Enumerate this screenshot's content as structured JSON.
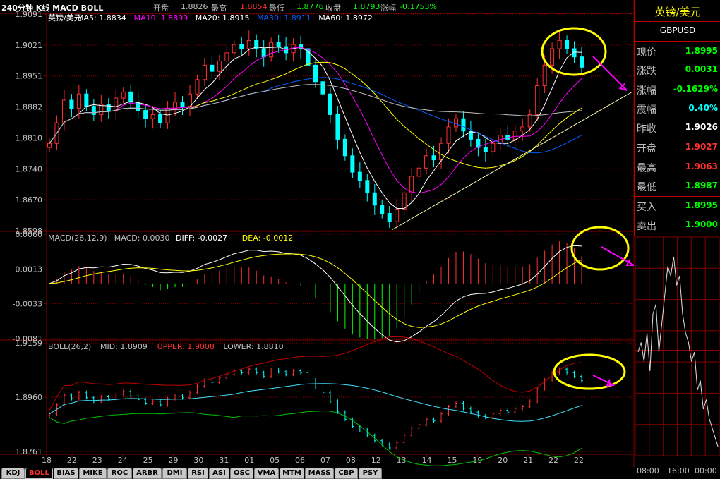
{
  "header": {
    "period_label": "240分钟 K线 MACD BOLL",
    "open_label": "开盘",
    "open_val": "1.8826",
    "high_label": "最高",
    "high_val": "1.8854",
    "low_label": "最低",
    "low_val": "1.8776",
    "close_label": "收盘",
    "close_val": "1.8793",
    "change_label": "涨幅",
    "change_val": "-0.1753%"
  },
  "side": {
    "title": "英镑/美元",
    "code": "GBPUSD",
    "rows": [
      {
        "label": "现价",
        "value": "1.8995",
        "color": "#00ff00"
      },
      {
        "label": "涨跌",
        "value": "0.0031",
        "color": "#00ff00"
      },
      {
        "label": "涨幅",
        "value": "-0.1629%",
        "color": "#00ff00"
      },
      {
        "label": "震幅",
        "value": "0.40%",
        "color": "#00ffff"
      },
      {
        "label": "昨收",
        "value": "1.9026",
        "color": "#ffffff"
      },
      {
        "label": "开盘",
        "value": "1.9027",
        "color": "#ff3030"
      },
      {
        "label": "最高",
        "value": "1.9063",
        "color": "#ff3030"
      },
      {
        "label": "最低",
        "value": "1.8987",
        "color": "#00ff00"
      },
      {
        "label": "买入",
        "value": "1.8995",
        "color": "#00ff00"
      },
      {
        "label": "卖出",
        "value": "1.9000",
        "color": "#00ff00"
      }
    ],
    "mini_times": [
      "08:00",
      "16:00",
      "00:00"
    ]
  },
  "tabs": [
    "KDJ",
    "BOLL",
    "BIAS",
    "MIKE",
    "ROC",
    "ARBR",
    "DMI",
    "RSI",
    "ASI",
    "OSC",
    "VMA",
    "MTM",
    "MASS",
    "CBP",
    "PSY"
  ],
  "active_tab": "BOLL",
  "colors": {
    "up": "#ff3030",
    "down": "#00ffff",
    "ma5": "#ffffff",
    "ma10": "#ff00ff",
    "ma20": "#ffff00",
    "ma30": "#0060ff",
    "ma60": "#ffffff",
    "grid": "#800000",
    "annotation": "#ffff00",
    "arrow": "#ff00ff"
  },
  "chart_data": [
    {
      "type": "candlestick",
      "name": "main",
      "legend": [
        {
          "text": "英镑/美元",
          "color": "#ffffff"
        },
        {
          "text": "MA5: 1.8834",
          "color": "#ffffff"
        },
        {
          "text": "MA10: 1.8899",
          "color": "#ff00ff"
        },
        {
          "text": "MA20: 1.8915",
          "color": "#ffffff"
        },
        {
          "text": "MA30: 1.8911",
          "color": "#0060ff"
        },
        {
          "text": "MA60: 1.8972",
          "color": "#ffffff"
        }
      ],
      "ylim": [
        1.8598,
        1.91
      ],
      "y_ticks": [
        "1.9091",
        "1.9021",
        "1.8951",
        "1.8882",
        "1.8810",
        "1.8740",
        "1.8670",
        "1.8598"
      ],
      "x_ticks": [
        "18",
        "22",
        "23",
        "24",
        "25",
        "29",
        "30",
        "31",
        "01",
        "05",
        "06",
        "07",
        "08",
        "12",
        "13",
        "14",
        "15",
        "19",
        "20",
        "21",
        "22",
        "22"
      ],
      "close": [
        1.881,
        1.886,
        1.8915,
        1.8895,
        1.893,
        1.89,
        1.888,
        1.8905,
        1.889,
        1.892,
        1.8935,
        1.891,
        1.889,
        1.887,
        1.888,
        1.886,
        1.8895,
        1.891,
        1.89,
        1.893,
        1.8965,
        1.9,
        1.8985,
        1.901,
        1.903,
        1.905,
        1.904,
        1.906,
        1.904,
        1.902,
        1.9055,
        1.9045,
        1.903,
        1.905,
        1.904,
        1.9,
        1.896,
        1.893,
        1.888,
        1.882,
        1.878,
        1.874,
        1.872,
        1.869,
        1.866,
        1.864,
        1.862,
        1.865,
        1.869,
        1.873,
        1.875,
        1.878,
        1.877,
        1.881,
        1.885,
        1.887,
        1.884,
        1.882,
        1.88,
        1.879,
        1.881,
        1.883,
        1.882,
        1.884,
        1.885,
        1.888,
        1.895,
        1.9,
        1.904,
        1.906,
        1.904,
        1.902,
        1.8995
      ]
    },
    {
      "type": "macd",
      "name": "macd",
      "legend": [
        {
          "text": "MACD(26,12,9)",
          "color": "#c0c0c0"
        },
        {
          "text": "MACD: 0.0030",
          "color": "#c0c0c0"
        },
        {
          "text": "DIFF: -0.0027",
          "color": "#ffffff"
        },
        {
          "text": "DEA: -0.0012",
          "color": "#ffff00"
        }
      ],
      "ylim": [
        -0.0081,
        0.006
      ],
      "y_ticks": [
        "0.0060",
        "0.0013",
        "-0.0033",
        "-0.0081"
      ]
    },
    {
      "type": "boll",
      "name": "boll",
      "legend": [
        {
          "text": "BOLL(26,2)",
          "color": "#c0c0c0"
        },
        {
          "text": "MID: 1.8909",
          "color": "#c0c0c0"
        },
        {
          "text": "UPPER: 1.9008",
          "color": "#ff3030"
        },
        {
          "text": "LOWER: 1.8810",
          "color": "#c0c0c0"
        }
      ],
      "ylim": [
        1.86,
        1.9159
      ],
      "y_ticks": [
        "1.9159",
        "1.8960",
        "1.8761"
      ]
    }
  ]
}
